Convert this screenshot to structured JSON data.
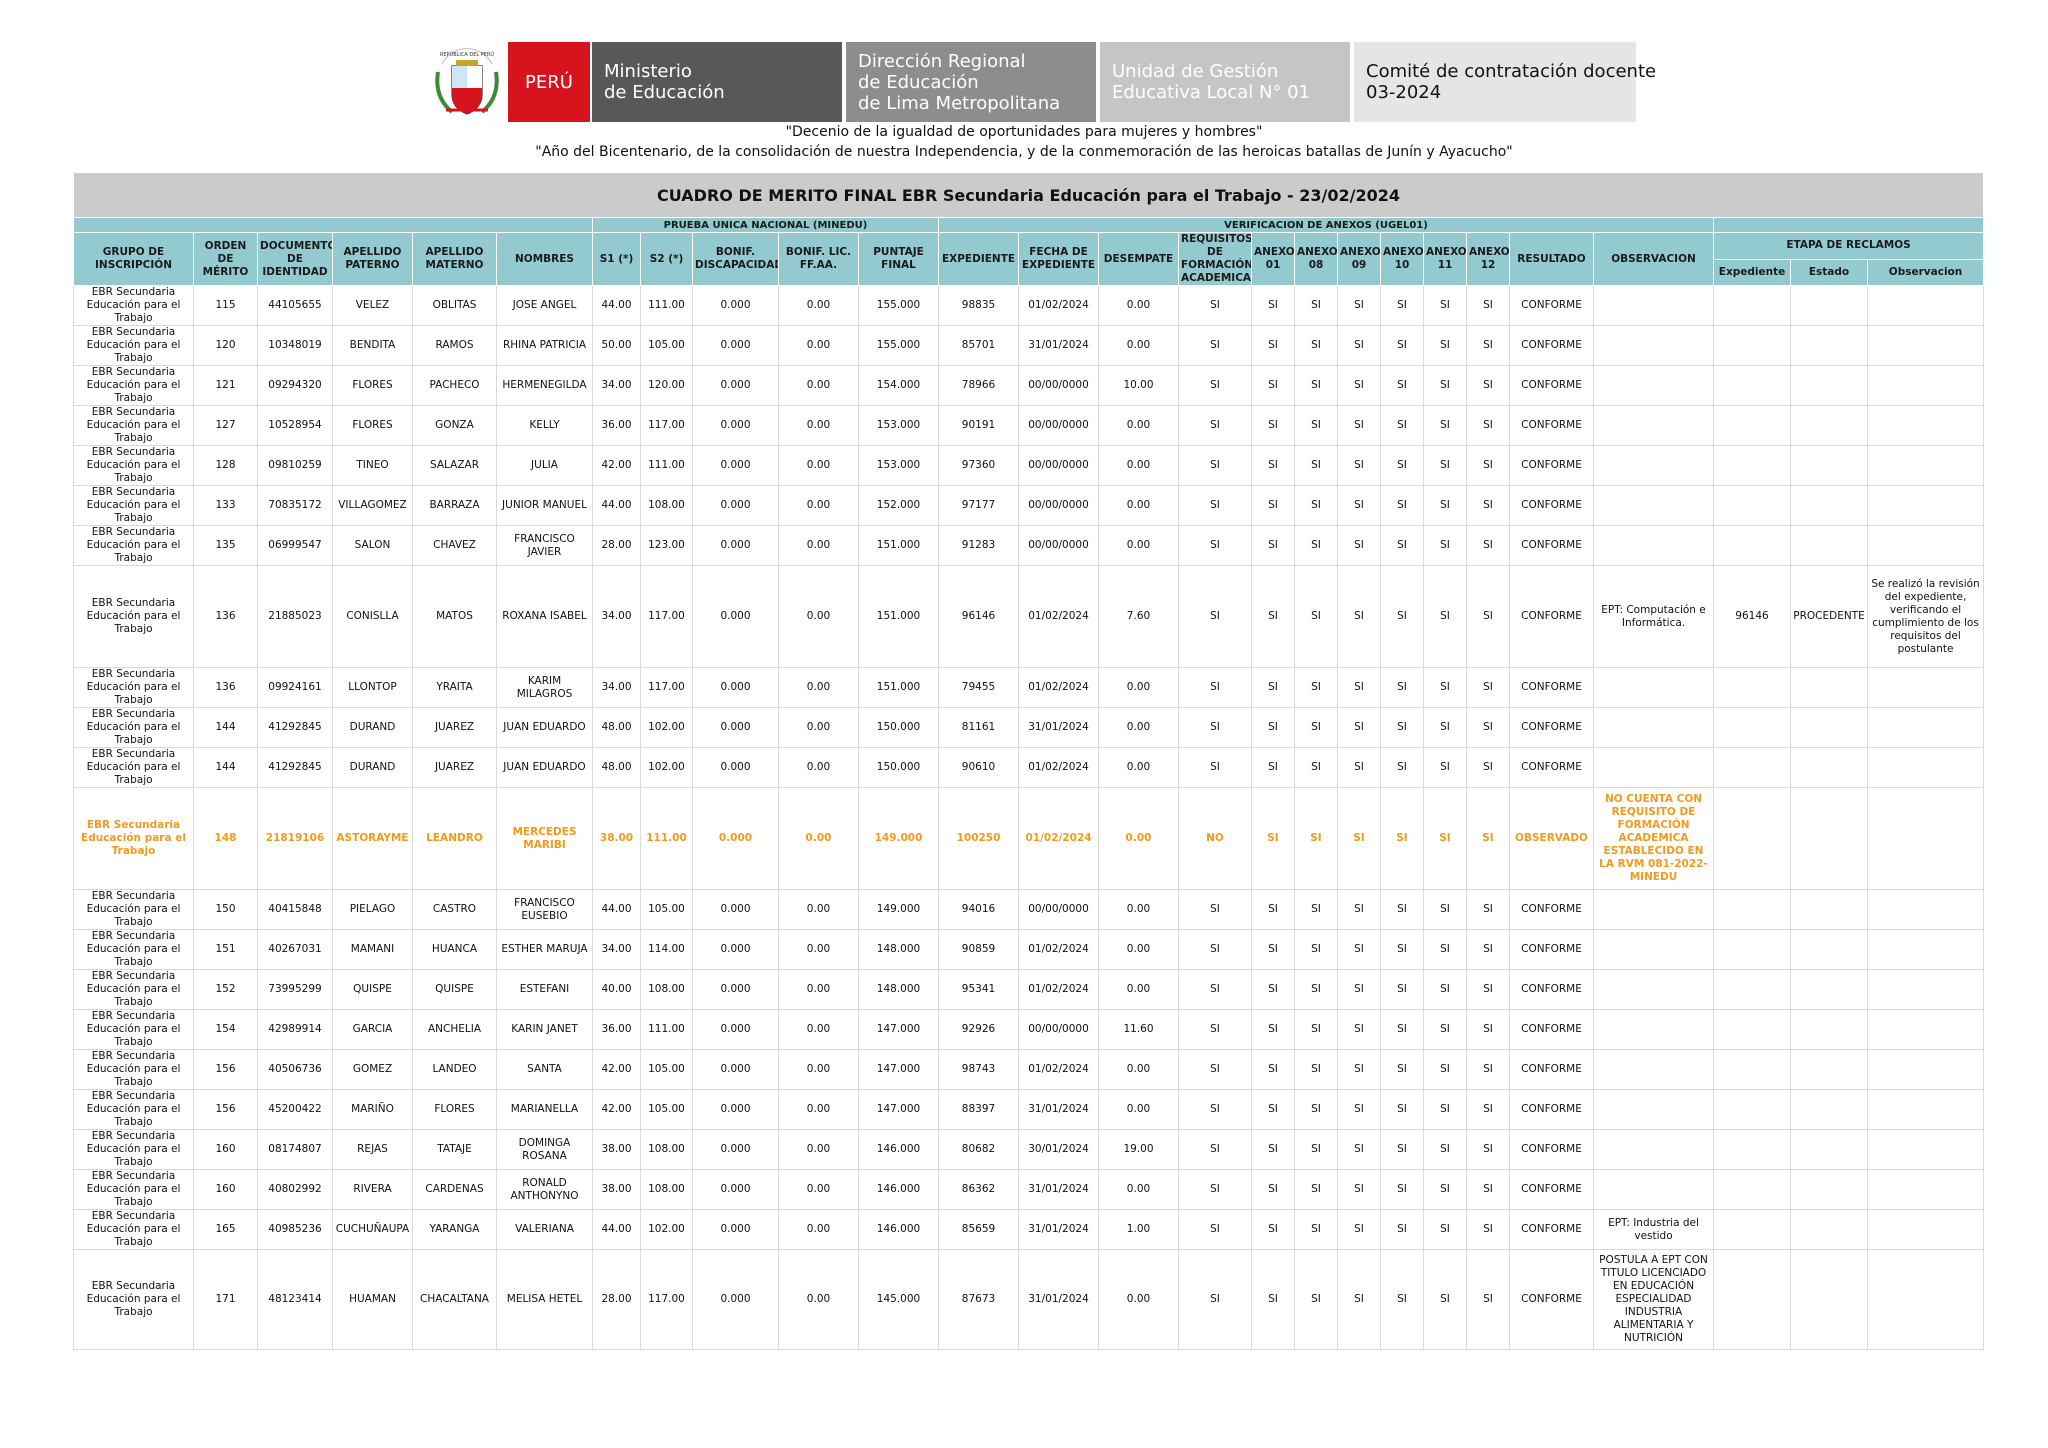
{
  "header": {
    "peru": "PERÚ",
    "crest_text": "REPÚBLICA DEL PERÚ",
    "ministerio": [
      "Ministerio",
      "de Educación"
    ],
    "direccion": [
      "Dirección Regional",
      "de Educación",
      "de Lima Metropolitana"
    ],
    "unidad": [
      "Unidad de Gestión",
      "Educativa Local N° 01"
    ],
    "comite": [
      "Comité de contratación docente",
      "03-2024"
    ]
  },
  "slogans": {
    "line1": "\"Decenio de la igualdad de oportunidades para mujeres y hombres\"",
    "line2": "\"Año del Bicentenario, de la consolidación de nuestra Independencia, y de la conmemoración de las heroicas batallas de Junín y Ayacucho\""
  },
  "colors": {
    "peru_red": "#d7141d",
    "header_teal": "#92cad0",
    "title_gray": "#cbcbcb",
    "observed_orange": "#f29a1c"
  },
  "table": {
    "title": "CUADRO DE MERITO FINAL EBR Secundaria Educación para el Trabajo - 23/02/2024",
    "group_pun": "PRUEBA UNICA NACIONAL (MINEDU)",
    "group_anexos": "VERIFICACION DE ANEXOS (UGEL01)",
    "group_reclamos": "ETAPA DE RECLAMOS",
    "headers": {
      "grupo": "GRUPO DE INSCRIPCIÓN",
      "orden": "ORDEN DE MÉRITO",
      "documento": "DOCUMENTO DE IDENTIDAD",
      "ap_paterno": "APELLIDO PATERNO",
      "ap_materno": "APELLIDO MATERNO",
      "nombres": "NOMBRES",
      "s1": "S1 (*)",
      "s2": "S2 (*)",
      "bonif_disc": "BONIF. DISCAPACIDAD",
      "bonif_lic": "BONIF. LIC. FF.AA.",
      "puntaje": "PUNTAJE FINAL",
      "expediente": "EXPEDIENTE",
      "fecha": "FECHA DE EXPEDIENTE",
      "desempate": "DESEMPATE",
      "requisitos": "REQUISITOS DE FORMACIÓN ACADEMICA",
      "anexo01": "ANEXO 01",
      "anexo08": "ANEXO 08",
      "anexo09": "ANEXO 09",
      "anexo10": "ANEXO 10",
      "anexo11": "ANEXO 11",
      "anexo12": "ANEXO 12",
      "resultado": "RESULTADO",
      "observacion": "OBSERVACION",
      "r_expediente": "Expediente",
      "r_estado": "Estado",
      "r_observacion": "Observacion"
    },
    "rows": [
      {
        "grupo": "EBR Secundaria Educación para el Trabajo",
        "orden": "115",
        "doc": "44105655",
        "pat": "VELEZ",
        "mat": "OBLITAS",
        "nom": "JOSE ANGEL",
        "s1": "44.00",
        "s2": "111.00",
        "bd": "0.000",
        "bl": "0.00",
        "pf": "155.000",
        "exp": "98835",
        "fecha": "01/02/2024",
        "des": "0.00",
        "req": "SI",
        "a01": "SI",
        "a08": "SI",
        "a09": "SI",
        "a10": "SI",
        "a11": "SI",
        "a12": "SI",
        "res": "CONFORME",
        "obs": "",
        "rexp": "",
        "rest": "",
        "robs": ""
      },
      {
        "grupo": "EBR Secundaria Educación para el Trabajo",
        "orden": "120",
        "doc": "10348019",
        "pat": "BENDITA",
        "mat": "RAMOS",
        "nom": "RHINA PATRICIA",
        "s1": "50.00",
        "s2": "105.00",
        "bd": "0.000",
        "bl": "0.00",
        "pf": "155.000",
        "exp": "85701",
        "fecha": "31/01/2024",
        "des": "0.00",
        "req": "SI",
        "a01": "SI",
        "a08": "SI",
        "a09": "SI",
        "a10": "SI",
        "a11": "SI",
        "a12": "SI",
        "res": "CONFORME",
        "obs": "",
        "rexp": "",
        "rest": "",
        "robs": ""
      },
      {
        "grupo": "EBR Secundaria Educación para el Trabajo",
        "orden": "121",
        "doc": "09294320",
        "pat": "FLORES",
        "mat": "PACHECO",
        "nom": "HERMENEGILDA",
        "s1": "34.00",
        "s2": "120.00",
        "bd": "0.000",
        "bl": "0.00",
        "pf": "154.000",
        "exp": "78966",
        "fecha": "00/00/0000",
        "des": "10.00",
        "req": "SI",
        "a01": "SI",
        "a08": "SI",
        "a09": "SI",
        "a10": "SI",
        "a11": "SI",
        "a12": "SI",
        "res": "CONFORME",
        "obs": "",
        "rexp": "",
        "rest": "",
        "robs": ""
      },
      {
        "grupo": "EBR Secundaria Educación para el Trabajo",
        "orden": "127",
        "doc": "10528954",
        "pat": "FLORES",
        "mat": "GONZA",
        "nom": "KELLY",
        "s1": "36.00",
        "s2": "117.00",
        "bd": "0.000",
        "bl": "0.00",
        "pf": "153.000",
        "exp": "90191",
        "fecha": "00/00/0000",
        "des": "0.00",
        "req": "SI",
        "a01": "SI",
        "a08": "SI",
        "a09": "SI",
        "a10": "SI",
        "a11": "SI",
        "a12": "SI",
        "res": "CONFORME",
        "obs": "",
        "rexp": "",
        "rest": "",
        "robs": ""
      },
      {
        "grupo": "EBR Secundaria Educación para el Trabajo",
        "orden": "128",
        "doc": "09810259",
        "pat": "TINEO",
        "mat": "SALAZAR",
        "nom": "JULIA",
        "s1": "42.00",
        "s2": "111.00",
        "bd": "0.000",
        "bl": "0.00",
        "pf": "153.000",
        "exp": "97360",
        "fecha": "00/00/0000",
        "des": "0.00",
        "req": "SI",
        "a01": "SI",
        "a08": "SI",
        "a09": "SI",
        "a10": "SI",
        "a11": "SI",
        "a12": "SI",
        "res": "CONFORME",
        "obs": "",
        "rexp": "",
        "rest": "",
        "robs": ""
      },
      {
        "grupo": "EBR Secundaria Educación para el Trabajo",
        "orden": "133",
        "doc": "70835172",
        "pat": "VILLAGOMEZ",
        "mat": "BARRAZA",
        "nom": "JUNIOR MANUEL",
        "s1": "44.00",
        "s2": "108.00",
        "bd": "0.000",
        "bl": "0.00",
        "pf": "152.000",
        "exp": "97177",
        "fecha": "00/00/0000",
        "des": "0.00",
        "req": "SI",
        "a01": "SI",
        "a08": "SI",
        "a09": "SI",
        "a10": "SI",
        "a11": "SI",
        "a12": "SI",
        "res": "CONFORME",
        "obs": "",
        "rexp": "",
        "rest": "",
        "robs": ""
      },
      {
        "grupo": "EBR Secundaria Educación para el Trabajo",
        "orden": "135",
        "doc": "06999547",
        "pat": "SALON",
        "mat": "CHAVEZ",
        "nom": "FRANCISCO JAVIER",
        "s1": "28.00",
        "s2": "123.00",
        "bd": "0.000",
        "bl": "0.00",
        "pf": "151.000",
        "exp": "91283",
        "fecha": "00/00/0000",
        "des": "0.00",
        "req": "SI",
        "a01": "SI",
        "a08": "SI",
        "a09": "SI",
        "a10": "SI",
        "a11": "SI",
        "a12": "SI",
        "res": "CONFORME",
        "obs": "",
        "rexp": "",
        "rest": "",
        "robs": ""
      },
      {
        "grupo": "EBR Secundaria Educación para el Trabajo",
        "orden": "136",
        "doc": "21885023",
        "pat": "CONISLLA",
        "mat": "MATOS",
        "nom": "ROXANA ISABEL",
        "s1": "34.00",
        "s2": "117.00",
        "bd": "0.000",
        "bl": "0.00",
        "pf": "151.000",
        "exp": "96146",
        "fecha": "01/02/2024",
        "des": "7.60",
        "req": "SI",
        "a01": "SI",
        "a08": "SI",
        "a09": "SI",
        "a10": "SI",
        "a11": "SI",
        "a12": "SI",
        "res": "CONFORME",
        "obs": "EPT: Computación e Informática.",
        "rexp": "96146",
        "rest": "PROCEDENTE",
        "robs": "Se realizó la revisión del expediente, verificando el cumplimiento de los requisitos del postulante"
      },
      {
        "grupo": "EBR Secundaria Educación para el Trabajo",
        "orden": "136",
        "doc": "09924161",
        "pat": "LLONTOP",
        "mat": "YRAITA",
        "nom": "KARIM MILAGROS",
        "s1": "34.00",
        "s2": "117.00",
        "bd": "0.000",
        "bl": "0.00",
        "pf": "151.000",
        "exp": "79455",
        "fecha": "01/02/2024",
        "des": "0.00",
        "req": "SI",
        "a01": "SI",
        "a08": "SI",
        "a09": "SI",
        "a10": "SI",
        "a11": "SI",
        "a12": "SI",
        "res": "CONFORME",
        "obs": "",
        "rexp": "",
        "rest": "",
        "robs": ""
      },
      {
        "grupo": "EBR Secundaria Educación para el Trabajo",
        "orden": "144",
        "doc": "41292845",
        "pat": "DURAND",
        "mat": "JUAREZ",
        "nom": "JUAN EDUARDO",
        "s1": "48.00",
        "s2": "102.00",
        "bd": "0.000",
        "bl": "0.00",
        "pf": "150.000",
        "exp": "81161",
        "fecha": "31/01/2024",
        "des": "0.00",
        "req": "SI",
        "a01": "SI",
        "a08": "SI",
        "a09": "SI",
        "a10": "SI",
        "a11": "SI",
        "a12": "SI",
        "res": "CONFORME",
        "obs": "",
        "rexp": "",
        "rest": "",
        "robs": ""
      },
      {
        "grupo": "EBR Secundaria Educación para el Trabajo",
        "orden": "144",
        "doc": "41292845",
        "pat": "DURAND",
        "mat": "JUAREZ",
        "nom": "JUAN EDUARDO",
        "s1": "48.00",
        "s2": "102.00",
        "bd": "0.000",
        "bl": "0.00",
        "pf": "150.000",
        "exp": "90610",
        "fecha": "01/02/2024",
        "des": "0.00",
        "req": "SI",
        "a01": "SI",
        "a08": "SI",
        "a09": "SI",
        "a10": "SI",
        "a11": "SI",
        "a12": "SI",
        "res": "CONFORME",
        "obs": "",
        "rexp": "",
        "rest": "",
        "robs": ""
      },
      {
        "grupo": "EBR Secundaria Educación para el Trabajo",
        "orden": "148",
        "doc": "21819106",
        "pat": "ASTORAYME",
        "mat": "LEANDRO",
        "nom": "MERCEDES MARIBI",
        "s1": "38.00",
        "s2": "111.00",
        "bd": "0.000",
        "bl": "0.00",
        "pf": "149.000",
        "exp": "100250",
        "fecha": "01/02/2024",
        "des": "0.00",
        "req": "NO",
        "a01": "SI",
        "a08": "SI",
        "a09": "SI",
        "a10": "SI",
        "a11": "SI",
        "a12": "SI",
        "res": "OBSERVADO",
        "obs": "NO CUENTA CON REQUISITO DE FORMACIÓN ACADEMICA ESTABLECIDO EN LA RVM 081-2022-MINEDU",
        "rexp": "",
        "rest": "",
        "robs": ""
      },
      {
        "grupo": "EBR Secundaria Educación para el Trabajo",
        "orden": "150",
        "doc": "40415848",
        "pat": "PIELAGO",
        "mat": "CASTRO",
        "nom": "FRANCISCO EUSEBIO",
        "s1": "44.00",
        "s2": "105.00",
        "bd": "0.000",
        "bl": "0.00",
        "pf": "149.000",
        "exp": "94016",
        "fecha": "00/00/0000",
        "des": "0.00",
        "req": "SI",
        "a01": "SI",
        "a08": "SI",
        "a09": "SI",
        "a10": "SI",
        "a11": "SI",
        "a12": "SI",
        "res": "CONFORME",
        "obs": "",
        "rexp": "",
        "rest": "",
        "robs": ""
      },
      {
        "grupo": "EBR Secundaria Educación para el Trabajo",
        "orden": "151",
        "doc": "40267031",
        "pat": "MAMANI",
        "mat": "HUANCA",
        "nom": "ESTHER MARUJA",
        "s1": "34.00",
        "s2": "114.00",
        "bd": "0.000",
        "bl": "0.00",
        "pf": "148.000",
        "exp": "90859",
        "fecha": "01/02/2024",
        "des": "0.00",
        "req": "SI",
        "a01": "SI",
        "a08": "SI",
        "a09": "SI",
        "a10": "SI",
        "a11": "SI",
        "a12": "SI",
        "res": "CONFORME",
        "obs": "",
        "rexp": "",
        "rest": "",
        "robs": ""
      },
      {
        "grupo": "EBR Secundaria Educación para el Trabajo",
        "orden": "152",
        "doc": "73995299",
        "pat": "QUISPE",
        "mat": "QUISPE",
        "nom": "ESTEFANI",
        "s1": "40.00",
        "s2": "108.00",
        "bd": "0.000",
        "bl": "0.00",
        "pf": "148.000",
        "exp": "95341",
        "fecha": "01/02/2024",
        "des": "0.00",
        "req": "SI",
        "a01": "SI",
        "a08": "SI",
        "a09": "SI",
        "a10": "SI",
        "a11": "SI",
        "a12": "SI",
        "res": "CONFORME",
        "obs": "",
        "rexp": "",
        "rest": "",
        "robs": ""
      },
      {
        "grupo": "EBR Secundaria Educación para el Trabajo",
        "orden": "154",
        "doc": "42989914",
        "pat": "GARCIA",
        "mat": "ANCHELIA",
        "nom": "KARIN JANET",
        "s1": "36.00",
        "s2": "111.00",
        "bd": "0.000",
        "bl": "0.00",
        "pf": "147.000",
        "exp": "92926",
        "fecha": "00/00/0000",
        "des": "11.60",
        "req": "SI",
        "a01": "SI",
        "a08": "SI",
        "a09": "SI",
        "a10": "SI",
        "a11": "SI",
        "a12": "SI",
        "res": "CONFORME",
        "obs": "",
        "rexp": "",
        "rest": "",
        "robs": ""
      },
      {
        "grupo": "EBR Secundaria Educación para el Trabajo",
        "orden": "156",
        "doc": "40506736",
        "pat": "GOMEZ",
        "mat": "LANDEO",
        "nom": "SANTA",
        "s1": "42.00",
        "s2": "105.00",
        "bd": "0.000",
        "bl": "0.00",
        "pf": "147.000",
        "exp": "98743",
        "fecha": "01/02/2024",
        "des": "0.00",
        "req": "SI",
        "a01": "SI",
        "a08": "SI",
        "a09": "SI",
        "a10": "SI",
        "a11": "SI",
        "a12": "SI",
        "res": "CONFORME",
        "obs": "",
        "rexp": "",
        "rest": "",
        "robs": ""
      },
      {
        "grupo": "EBR Secundaria Educación para el Trabajo",
        "orden": "156",
        "doc": "45200422",
        "pat": "MARIÑO",
        "mat": "FLORES",
        "nom": "MARIANELLA",
        "s1": "42.00",
        "s2": "105.00",
        "bd": "0.000",
        "bl": "0.00",
        "pf": "147.000",
        "exp": "88397",
        "fecha": "31/01/2024",
        "des": "0.00",
        "req": "SI",
        "a01": "SI",
        "a08": "SI",
        "a09": "SI",
        "a10": "SI",
        "a11": "SI",
        "a12": "SI",
        "res": "CONFORME",
        "obs": "",
        "rexp": "",
        "rest": "",
        "robs": ""
      },
      {
        "grupo": "EBR Secundaria Educación para el Trabajo",
        "orden": "160",
        "doc": "08174807",
        "pat": "REJAS",
        "mat": "TATAJE",
        "nom": "DOMINGA ROSANA",
        "s1": "38.00",
        "s2": "108.00",
        "bd": "0.000",
        "bl": "0.00",
        "pf": "146.000",
        "exp": "80682",
        "fecha": "30/01/2024",
        "des": "19.00",
        "req": "SI",
        "a01": "SI",
        "a08": "SI",
        "a09": "SI",
        "a10": "SI",
        "a11": "SI",
        "a12": "SI",
        "res": "CONFORME",
        "obs": "",
        "rexp": "",
        "rest": "",
        "robs": ""
      },
      {
        "grupo": "EBR Secundaria Educación para el Trabajo",
        "orden": "160",
        "doc": "40802992",
        "pat": "RIVERA",
        "mat": "CARDENAS",
        "nom": "RONALD ANTHONYNO",
        "s1": "38.00",
        "s2": "108.00",
        "bd": "0.000",
        "bl": "0.00",
        "pf": "146.000",
        "exp": "86362",
        "fecha": "31/01/2024",
        "des": "0.00",
        "req": "SI",
        "a01": "SI",
        "a08": "SI",
        "a09": "SI",
        "a10": "SI",
        "a11": "SI",
        "a12": "SI",
        "res": "CONFORME",
        "obs": "",
        "rexp": "",
        "rest": "",
        "robs": ""
      },
      {
        "grupo": "EBR Secundaria Educación para el Trabajo",
        "orden": "165",
        "doc": "40985236",
        "pat": "CUCHUÑAUPA",
        "mat": "YARANGA",
        "nom": "VALERIANA",
        "s1": "44.00",
        "s2": "102.00",
        "bd": "0.000",
        "bl": "0.00",
        "pf": "146.000",
        "exp": "85659",
        "fecha": "31/01/2024",
        "des": "1.00",
        "req": "SI",
        "a01": "SI",
        "a08": "SI",
        "a09": "SI",
        "a10": "SI",
        "a11": "SI",
        "a12": "SI",
        "res": "CONFORME",
        "obs": "EPT: Industria del vestido",
        "rexp": "",
        "rest": "",
        "robs": ""
      },
      {
        "grupo": "EBR Secundaria Educación para el Trabajo",
        "orden": "171",
        "doc": "48123414",
        "pat": "HUAMAN",
        "mat": "CHACALTANA",
        "nom": "MELISA HETEL",
        "s1": "28.00",
        "s2": "117.00",
        "bd": "0.000",
        "bl": "0.00",
        "pf": "145.000",
        "exp": "87673",
        "fecha": "31/01/2024",
        "des": "0.00",
        "req": "SI",
        "a01": "SI",
        "a08": "SI",
        "a09": "SI",
        "a10": "SI",
        "a11": "SI",
        "a12": "SI",
        "res": "CONFORME",
        "obs": "POSTULA A EPT CON TITULO LICENCIADO EN EDUCACIÓN ESPECIALIDAD INDUSTRIA ALIMENTARIA Y NUTRICIÓN",
        "rexp": "",
        "rest": "",
        "robs": ""
      }
    ]
  }
}
